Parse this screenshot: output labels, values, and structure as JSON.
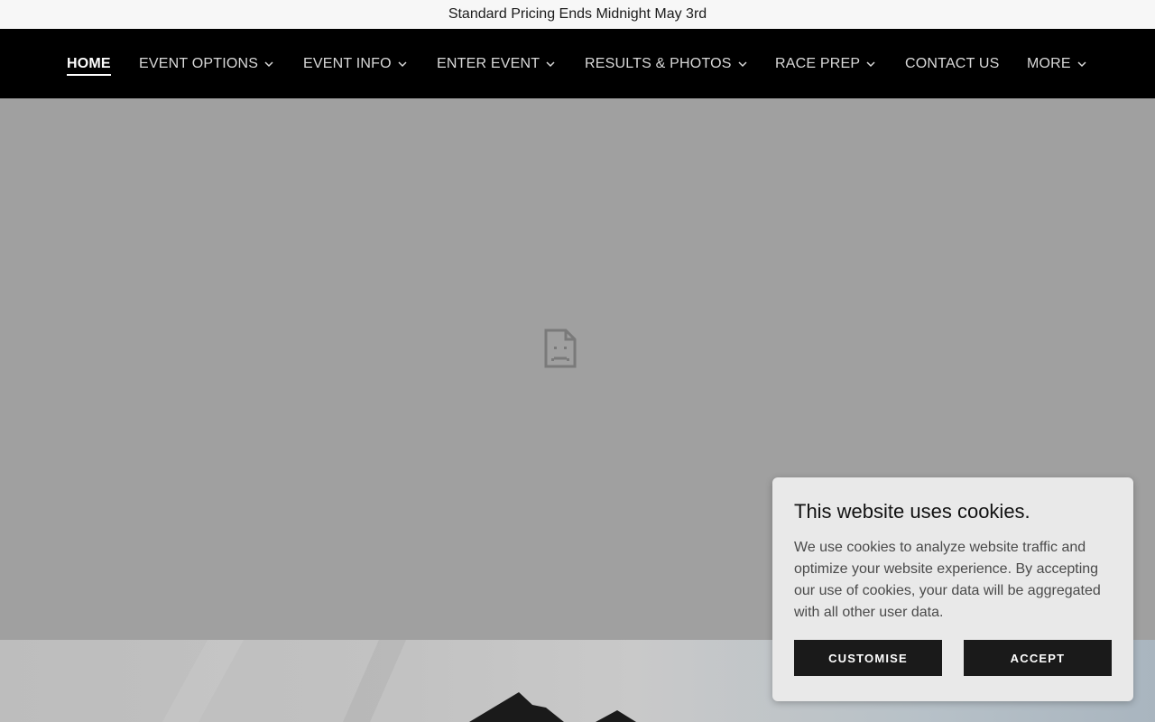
{
  "announcement": {
    "text": "Standard Pricing Ends Midnight May 3rd"
  },
  "nav": {
    "items": [
      {
        "label": "HOME",
        "active": true,
        "dropdown": false
      },
      {
        "label": "EVENT OPTIONS",
        "active": false,
        "dropdown": true
      },
      {
        "label": "EVENT INFO",
        "active": false,
        "dropdown": true
      },
      {
        "label": "ENTER EVENT",
        "active": false,
        "dropdown": true
      },
      {
        "label": "RESULTS & PHOTOS",
        "active": false,
        "dropdown": true
      },
      {
        "label": "RACE PREP",
        "active": false,
        "dropdown": true
      },
      {
        "label": "CONTACT US",
        "active": false,
        "dropdown": false
      },
      {
        "label": "MORE",
        "active": false,
        "dropdown": true
      }
    ]
  },
  "hero": {
    "icon": "broken-document-icon"
  },
  "cookie_banner": {
    "title": "This website uses cookies.",
    "body": "We use cookies to analyze website traffic and optimize your website experience. By accepting our use of cookies, your data will be aggregated with all other user data.",
    "customise_label": "CUSTOMISE",
    "accept_label": "ACCEPT"
  },
  "colors": {
    "nav_background": "#000000",
    "announcement_background": "#f7f7f7",
    "hero_background": "#a0a0a0",
    "button_background": "#1a1a1a",
    "cookie_background": "#e9e9e9"
  }
}
